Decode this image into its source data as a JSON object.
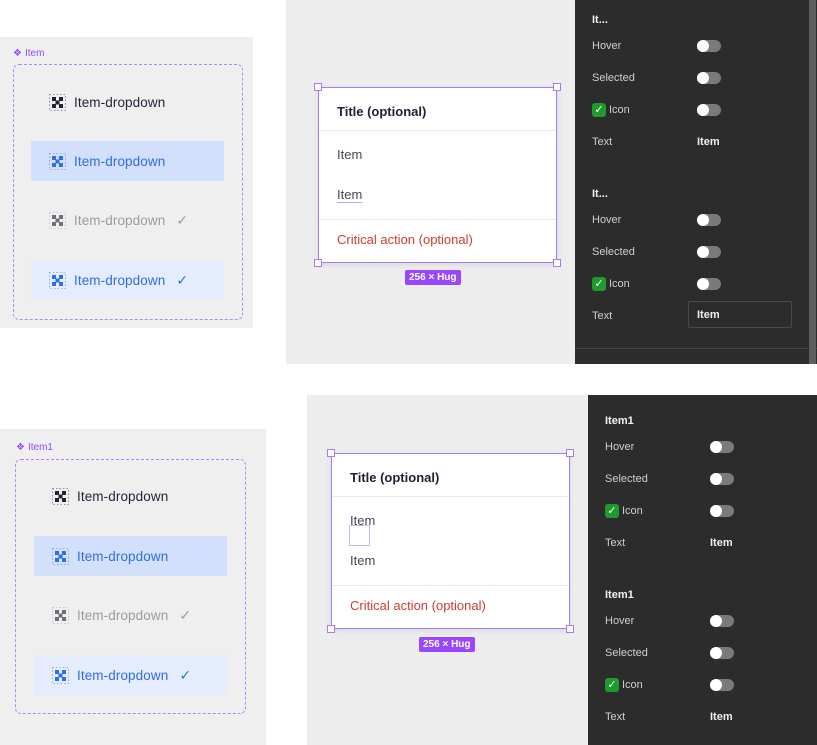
{
  "colors": {
    "component_purple": "#9747ff",
    "hover_bg": "#d3e0fb",
    "selected_bg": "#e5ecfd",
    "accent_blue": "#2e6ee6",
    "critical_red": "#cc3d2f",
    "panel_dark": "#2c2c2c"
  },
  "variant_sets": [
    {
      "component_name": "Item",
      "items": [
        {
          "label": "Item-dropdown",
          "state": "default",
          "icon": "component-placeholder-icon",
          "check": ""
        },
        {
          "label": "Item-dropdown",
          "state": "hover",
          "icon": "component-placeholder-icon",
          "check": ""
        },
        {
          "label": "Item-dropdown",
          "state": "disabled-selected",
          "icon": "component-placeholder-icon",
          "check": "✓"
        },
        {
          "label": "Item-dropdown",
          "state": "selected",
          "icon": "component-placeholder-icon",
          "check": "✓"
        }
      ]
    },
    {
      "component_name": "Item1",
      "items": [
        {
          "label": "Item-dropdown",
          "state": "default",
          "icon": "component-placeholder-icon",
          "check": ""
        },
        {
          "label": "Item-dropdown",
          "state": "hover",
          "icon": "component-placeholder-icon",
          "check": ""
        },
        {
          "label": "Item-dropdown",
          "state": "disabled-selected",
          "icon": "component-placeholder-icon",
          "check": "✓"
        },
        {
          "label": "Item-dropdown",
          "state": "selected",
          "icon": "component-placeholder-icon",
          "check": "✓"
        }
      ]
    }
  ],
  "menus": [
    {
      "title": "Title (optional)",
      "items": [
        "Item",
        "Item"
      ],
      "critical": "Critical action (optional)",
      "size_badge": "256 × Hug"
    },
    {
      "title": "Title (optional)",
      "items": [
        "Item",
        "Item"
      ],
      "critical": "Critical action (optional)",
      "size_badge": "256 × Hug"
    }
  ],
  "property_panels": [
    {
      "groups": [
        {
          "title": "It...",
          "hover_label": "Hover",
          "hover": false,
          "selected_label": "Selected",
          "selected": false,
          "icon_label": "Icon",
          "icon_emoji": "✓",
          "icon": false,
          "text_label": "Text",
          "text_value": "Item"
        },
        {
          "title": "It...",
          "hover_label": "Hover",
          "hover": false,
          "selected_label": "Selected",
          "selected": false,
          "icon_label": "Icon",
          "icon_emoji": "✓",
          "icon": false,
          "text_label": "Text",
          "text_value": "Item"
        }
      ]
    },
    {
      "groups": [
        {
          "title": "Item1",
          "hover_label": "Hover",
          "hover": false,
          "selected_label": "Selected",
          "selected": false,
          "icon_label": "Icon",
          "icon_emoji": "✓",
          "icon": false,
          "text_label": "Text",
          "text_value": "Item"
        },
        {
          "title": "Item1",
          "hover_label": "Hover",
          "hover": false,
          "selected_label": "Selected",
          "selected": false,
          "icon_label": "Icon",
          "icon_emoji": "✓",
          "icon": false,
          "text_label": "Text",
          "text_value": "Item"
        }
      ]
    }
  ]
}
